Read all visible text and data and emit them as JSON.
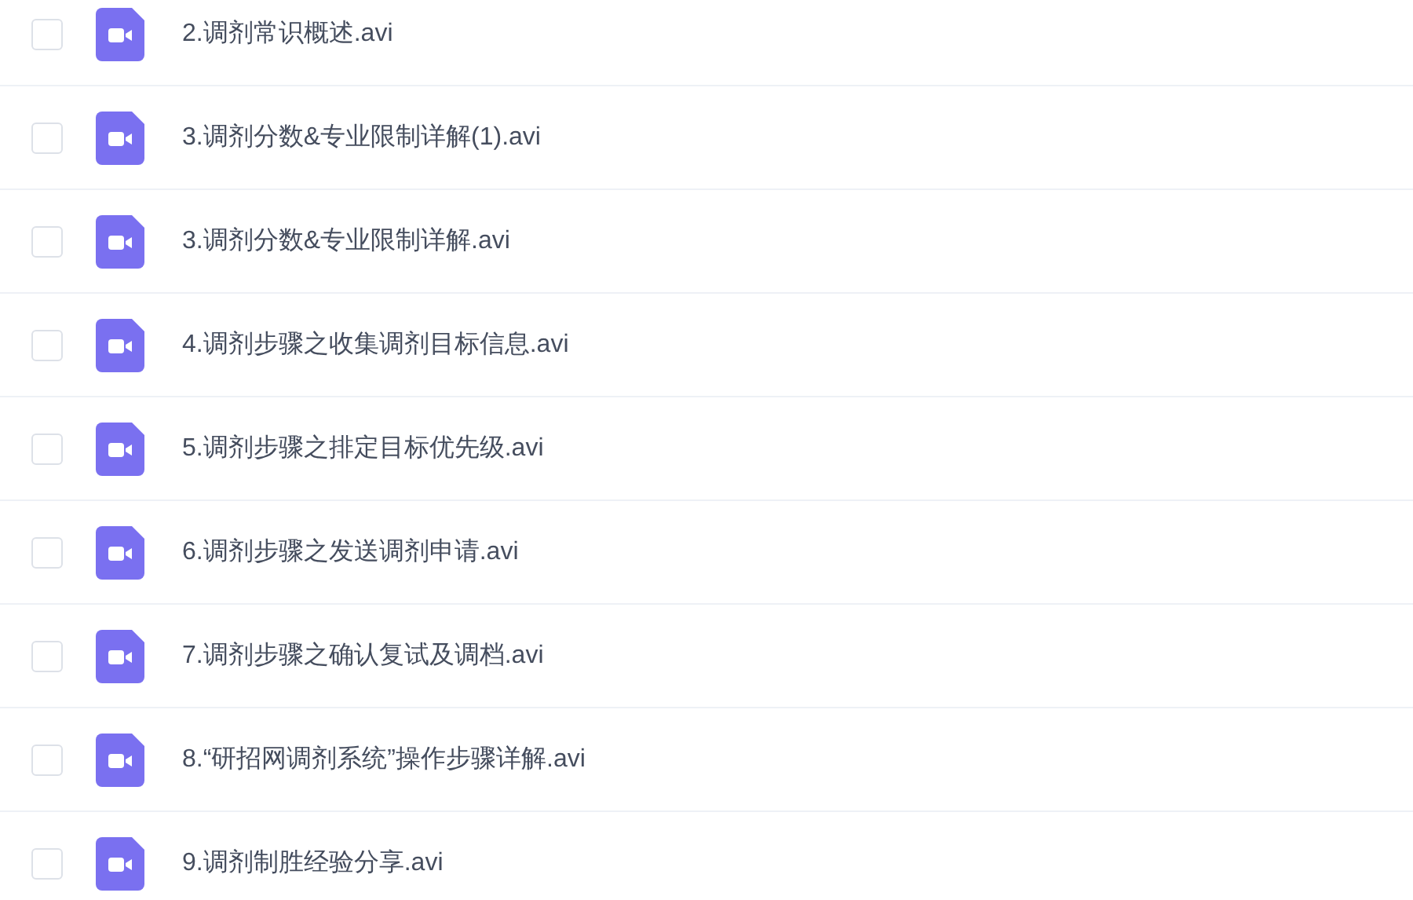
{
  "files": [
    {
      "name": "2.调剂常识概述.avi",
      "checked": false
    },
    {
      "name": "3.调剂分数&专业限制详解(1).avi",
      "checked": false
    },
    {
      "name": "3.调剂分数&专业限制详解.avi",
      "checked": false
    },
    {
      "name": "4.调剂步骤之收集调剂目标信息.avi",
      "checked": false
    },
    {
      "name": "5.调剂步骤之排定目标优先级.avi",
      "checked": false
    },
    {
      "name": "6.调剂步骤之发送调剂申请.avi",
      "checked": false
    },
    {
      "name": "7.调剂步骤之确认复试及调档.avi",
      "checked": false
    },
    {
      "name": "8.“研招网调剂系统”操作步骤详解.avi",
      "checked": false
    },
    {
      "name": "9.调剂制胜经验分享.avi",
      "checked": false
    }
  ]
}
